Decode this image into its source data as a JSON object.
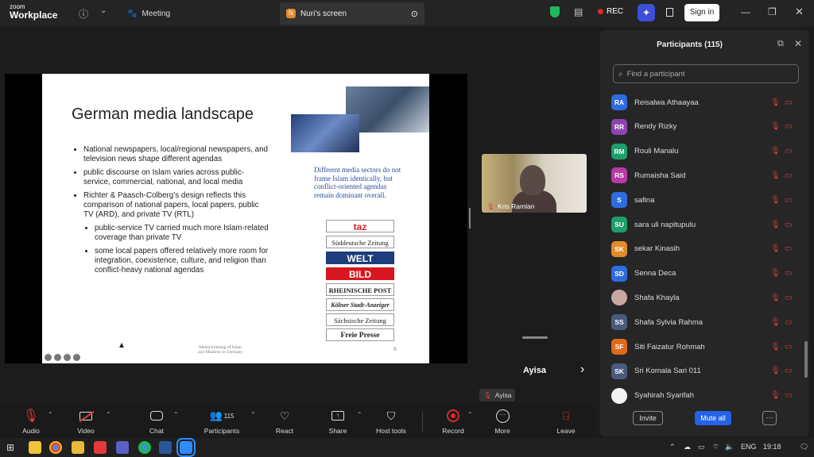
{
  "app": {
    "logo_small": "zoom",
    "logo_big": "Workplace",
    "meeting_tab": "Meeting",
    "share_tab": "Nuri's screen",
    "share_badge": "N",
    "rec_label": "REC",
    "signin_label": "Sign in"
  },
  "slide": {
    "title": "German media landscape",
    "bullets": [
      "National newspapers, local/regional newspapers, and television news shape different agendas",
      "public discourse on Islam varies across public-service, commercial, national, and local media",
      "Richter & Paasch-Colberg’s design reflects this comparison of national papers, local papers, public TV (ARD), and private TV (RTL)"
    ],
    "sub_bullets": [
      "public-service TV carried much more Islam-related coverage than private TV",
      "some local papers offered relatively more room for integration, coexistence, culture, and religion than conflict-heavy national agendas"
    ],
    "note": "Different media sectors do not frame Islam identically, but conflict-oriented agendas remain dominant overall.",
    "mastheads": [
      "taz",
      "Süddeutsche Zeitung",
      "WELT",
      "BILD",
      "RHEINISCHE POST",
      "Kölner Stadt-Anzeiger",
      "Sächsische Zeitung",
      "Freie Presse"
    ],
    "footer_line1": "Media Framing of Islam",
    "footer_line2": "and Muslims in Germany",
    "page_number": "6"
  },
  "speaker": {
    "name": "Kris Ramlan"
  },
  "gallery": {
    "active_label": "Ayisa",
    "tag_label": "Ayisa"
  },
  "toolbar": {
    "audio": "Audio",
    "video": "Video",
    "chat": "Chat",
    "participants": "Participants",
    "participants_count": "115",
    "react": "React",
    "share": "Share",
    "host_tools": "Host tools",
    "record": "Record",
    "more": "More",
    "leave": "Leave"
  },
  "panel": {
    "title": "Participants (115)",
    "search_placeholder": "Find a participant",
    "invite": "Invite",
    "mute_all": "Mute all",
    "more": "···",
    "participants": [
      {
        "initials": "RA",
        "name": "Reisalwa Athaayaa",
        "color": "#2d6cdf"
      },
      {
        "initials": "RR",
        "name": "Rendy Rizky",
        "color": "#8e44ad"
      },
      {
        "initials": "RM",
        "name": "Rouli Manalu",
        "color": "#1e9e6a"
      },
      {
        "initials": "RS",
        "name": "Rumaisha Said",
        "color": "#b93aa4"
      },
      {
        "initials": "S",
        "name": "safina",
        "color": "#2d6cdf"
      },
      {
        "initials": "SU",
        "name": "sara uli napitupulu",
        "color": "#1e9e6a"
      },
      {
        "initials": "SK",
        "name": "sekar Kinasih",
        "color": "#e38b2b"
      },
      {
        "initials": "SD",
        "name": "Senna Deca",
        "color": "#2d6cdf"
      },
      {
        "initials": "",
        "name": "Shafa Khayla",
        "color": "#c9a7a0"
      },
      {
        "initials": "SS",
        "name": "Shafa Sylvia Rahma",
        "color": "#4a5a7a"
      },
      {
        "initials": "SF",
        "name": "Siti Faizatur Rohmah",
        "color": "#e06a1a"
      },
      {
        "initials": "SK",
        "name": "Sri Komala Sari 011",
        "color": "#4a5a7a"
      },
      {
        "initials": "",
        "name": "Syahirah Syarifah",
        "color": "#f2f2f2"
      }
    ]
  },
  "taskbar": {
    "lang": "ENG",
    "time": "19:18"
  }
}
